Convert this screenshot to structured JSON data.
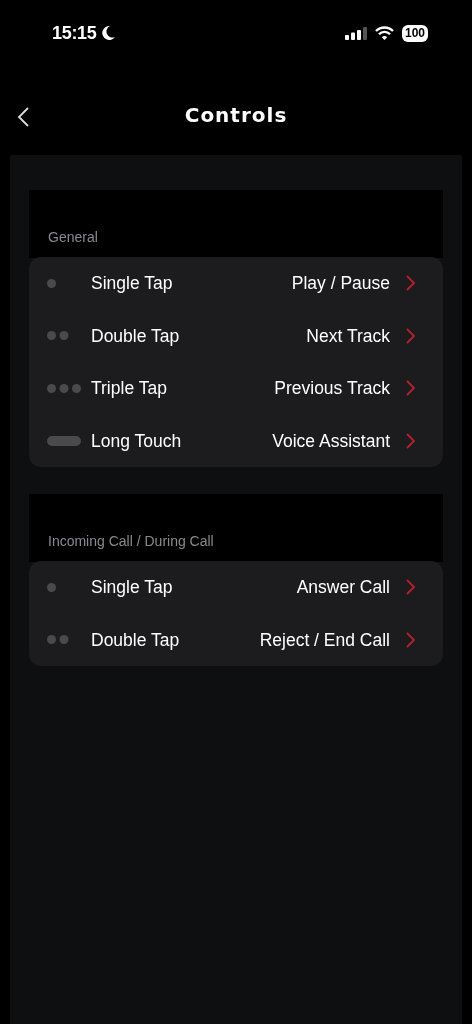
{
  "status_bar": {
    "time": "15:15",
    "battery": "100"
  },
  "header": {
    "title": "Controls"
  },
  "sections": [
    {
      "title": "General",
      "rows": [
        {
          "kind": "single",
          "gesture": "Single Tap",
          "action": "Play / Pause"
        },
        {
          "kind": "double",
          "gesture": "Double Tap",
          "action": "Next Track"
        },
        {
          "kind": "triple",
          "gesture": "Triple Tap",
          "action": "Previous Track"
        },
        {
          "kind": "long",
          "gesture": "Long Touch",
          "action": "Voice Assistant"
        }
      ]
    },
    {
      "title": "Incoming Call / During Call",
      "rows": [
        {
          "kind": "single",
          "gesture": "Single Tap",
          "action": "Answer Call"
        },
        {
          "kind": "double",
          "gesture": "Double Tap",
          "action": "Reject / End Call"
        }
      ]
    }
  ]
}
